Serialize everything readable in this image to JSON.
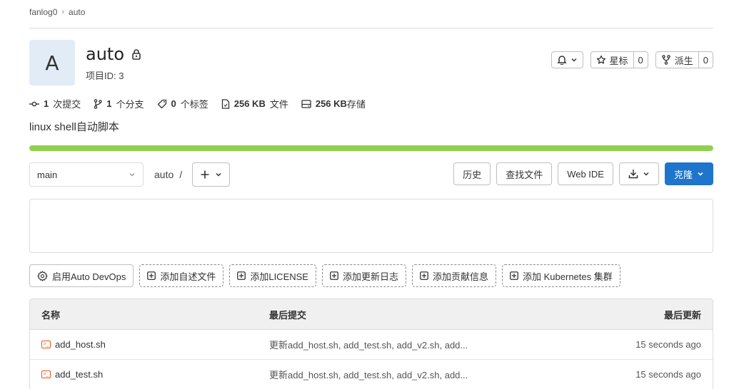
{
  "breadcrumb": {
    "owner": "fanlog0",
    "project": "auto"
  },
  "project": {
    "avatar_letter": "A",
    "name": "auto",
    "id_label": "项目ID: 3"
  },
  "header_actions": {
    "star_label": "星标",
    "star_count": "0",
    "fork_label": "派生",
    "fork_count": "0"
  },
  "stats": {
    "commits_value": "1",
    "commits_label": "次提交",
    "branches_value": "1",
    "branches_label": "个分支",
    "tags_value": "0",
    "tags_label": "个标签",
    "files_value": "256 KB",
    "files_label": "文件",
    "storage_value": "256 KB",
    "storage_label": "存储"
  },
  "description": "linux shell自动脚本",
  "storage_progress": 1.0,
  "branch": {
    "selected": "main"
  },
  "path": {
    "root": "auto",
    "sep": "/"
  },
  "toolbar": {
    "history": "历史",
    "find_file": "查找文件",
    "web_ide": "Web IDE",
    "clone": "克隆"
  },
  "quick_actions": [
    {
      "label": "启用Auto DevOps",
      "icon": "gear-icon"
    },
    {
      "label": "添加自述文件",
      "icon": "plus-square-icon"
    },
    {
      "label": "添加LICENSE",
      "icon": "plus-square-icon"
    },
    {
      "label": "添加更新日志",
      "icon": "plus-square-icon"
    },
    {
      "label": "添加贡献信息",
      "icon": "plus-square-icon"
    },
    {
      "label": "添加 Kubernetes 集群",
      "icon": "plus-square-icon"
    }
  ],
  "table": {
    "headers": {
      "name": "名称",
      "last_commit": "最后提交",
      "last_update": "最后更新"
    },
    "rows": [
      {
        "name": "add_host.sh",
        "commit": "更新add_host.sh, add_test.sh, add_v2.sh, add...",
        "updated": "15 seconds ago"
      },
      {
        "name": "add_test.sh",
        "commit": "更新add_host.sh, add_test.sh, add_v2.sh, add...",
        "updated": "15 seconds ago"
      }
    ]
  },
  "colors": {
    "primary": "#1f75cb",
    "progress": "#8fd14f",
    "file_icon": "#e2591d",
    "avatar_bg": "#e1ecf7"
  }
}
